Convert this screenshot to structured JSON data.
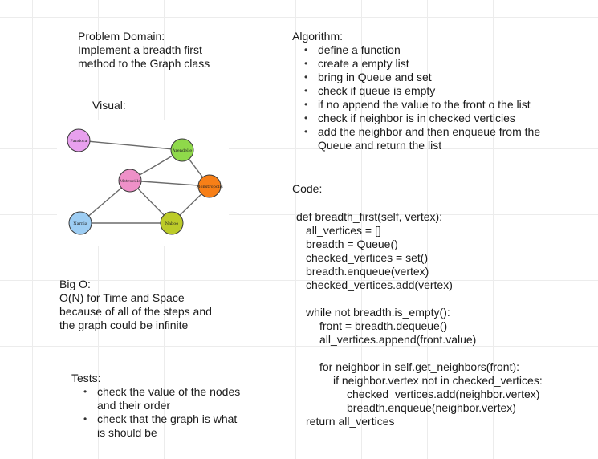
{
  "problem_domain": {
    "title": "Problem Domain:",
    "lines": [
      "Implement a breadth first",
      "method to the Graph class"
    ]
  },
  "visual": {
    "label": "Visual:",
    "nodes": [
      {
        "id": "n1",
        "label": "Pandora",
        "color": "#e8a0ee"
      },
      {
        "id": "n2",
        "label": "Arendelle",
        "color": "#8fd94a"
      },
      {
        "id": "n3",
        "label": "Metroville",
        "color": "#ee90c8"
      },
      {
        "id": "n4",
        "label": "Monstropolis",
        "color": "#f77f17"
      },
      {
        "id": "n5",
        "label": "Narnia",
        "color": "#9dcdf3"
      },
      {
        "id": "n6",
        "label": "Naboo",
        "color": "#bccb29"
      }
    ],
    "edges": [
      [
        "n1",
        "n2"
      ],
      [
        "n2",
        "n3"
      ],
      [
        "n2",
        "n4"
      ],
      [
        "n3",
        "n4"
      ],
      [
        "n3",
        "n5"
      ],
      [
        "n3",
        "n6"
      ],
      [
        "n5",
        "n6"
      ],
      [
        "n4",
        "n6"
      ]
    ]
  },
  "big_o": {
    "title": "Big O:",
    "lines": [
      "O(N) for Time and Space",
      "because of all of the steps and",
      "the graph could be infinite"
    ]
  },
  "tests": {
    "title": "Tests:",
    "items": [
      "check the value of the nodes and their order",
      "check that the graph is what is should be"
    ]
  },
  "algorithm": {
    "title": "Algorithm:",
    "items": [
      "define a function",
      "create a empty list",
      "bring in Queue and set",
      "check if queue is empty",
      "if no append the value to the front o the list",
      "check if neighbor is in checked verticies",
      "add the neighbor and then enqueue from the Queue and return the list"
    ]
  },
  "code": {
    "title": "Code:",
    "lines": [
      {
        "indent": 0,
        "text": "def breadth_first(self, vertex):"
      },
      {
        "indent": 1,
        "text": "all_vertices = []"
      },
      {
        "indent": 1,
        "text": "breadth = Queue()"
      },
      {
        "indent": 1,
        "text": "checked_vertices = set()"
      },
      {
        "indent": 1,
        "text": "breadth.enqueue(vertex)"
      },
      {
        "indent": 1,
        "text": "checked_vertices.add(vertex)"
      },
      {
        "indent": 0,
        "text": ""
      },
      {
        "indent": 1,
        "text": "while not breadth.is_empty():"
      },
      {
        "indent": 2,
        "text": "front = breadth.dequeue()"
      },
      {
        "indent": 2,
        "text": "all_vertices.append(front.value)"
      },
      {
        "indent": 0,
        "text": ""
      },
      {
        "indent": 2,
        "text": "for neighbor in self.get_neighbors(front):"
      },
      {
        "indent": 3,
        "text": "if neighbor.vertex not in checked_vertices:"
      },
      {
        "indent": 4,
        "text": "checked_vertices.add(neighbor.vertex)"
      },
      {
        "indent": 4,
        "text": "breadth.enqueue(neighbor.vertex)"
      },
      {
        "indent": 1,
        "text": "return all_vertices"
      }
    ]
  }
}
